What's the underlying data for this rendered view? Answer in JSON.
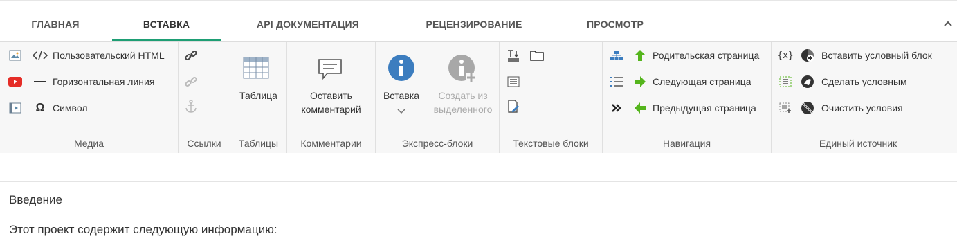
{
  "tabs": [
    "ГЛАВНАЯ",
    "ВСТАВКА",
    "API ДОКУМЕНТАЦИЯ",
    "РЕЦЕНЗИРОВАНИЕ",
    "ПРОСМОТР"
  ],
  "media": {
    "label": "Медиа",
    "html": "Пользовательский HTML",
    "hline": "Горизонтальная линия",
    "symbol": "Символ"
  },
  "links": {
    "label": "Ссылки"
  },
  "tables": {
    "label": "Таблицы",
    "table": "Таблица"
  },
  "comments": {
    "label": "Комментарии",
    "leave1": "Оставить",
    "leave2": "комментарий"
  },
  "express": {
    "label": "Экспресс-блоки",
    "insert": "Вставка",
    "create1": "Создать из",
    "create2": "выделенного"
  },
  "textblocks": {
    "label": "Текстовые блоки"
  },
  "nav": {
    "label": "Навигация",
    "parent": "Родительская страница",
    "next": "Следующая страница",
    "prev": "Предыдущая страница"
  },
  "single": {
    "label": "Единый источник",
    "insert": "Вставить условный блок",
    "make": "Сделать условным",
    "clear": "Очистить условия"
  },
  "doc": {
    "line1": "Введение",
    "line2": "Этот проект содержит следующую информацию:"
  },
  "colors": {
    "accent": "#1e9e74",
    "info": "#3c7dbf",
    "green": "#55b51d"
  }
}
